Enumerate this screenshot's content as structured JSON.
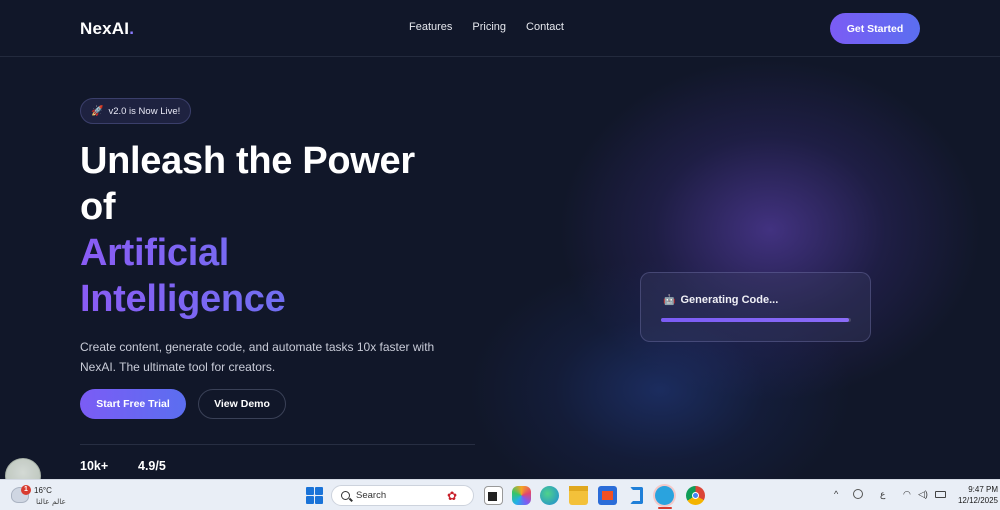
{
  "header": {
    "logo_main": "NexAI",
    "logo_dot": ".",
    "nav": [
      "Features",
      "Pricing",
      "Contact"
    ],
    "cta": "Get Started"
  },
  "hero": {
    "badge_icon": "rocket-icon",
    "badge_text": "v2.0 is Now Live!",
    "title_line1": "Unleash the Power",
    "title_line2": "of",
    "title_line3": "Artificial",
    "title_line4": "Intelligence",
    "subtitle_line1": "Create content, generate code, and automate tasks 10x faster with",
    "subtitle_line2": "NexAI. The ultimate tool for creators.",
    "primary_button": "Start Free Trial",
    "secondary_button": "View Demo",
    "stats": [
      "10k+",
      "4.9/5"
    ]
  },
  "card": {
    "icon": "robot-icon",
    "title": "Generating Code...",
    "progress": 0.99
  },
  "taskbar": {
    "weather_temp": "16°C",
    "weather_city": "عالم عالنا",
    "weather_badge": "1",
    "search_placeholder": "Search",
    "ime": "ع",
    "time": "9:47 PM",
    "date": "12/12/2025"
  },
  "colors": {
    "accent": "#7b5cf5",
    "accent_blue": "#5b6ef0",
    "background": "#111729"
  }
}
